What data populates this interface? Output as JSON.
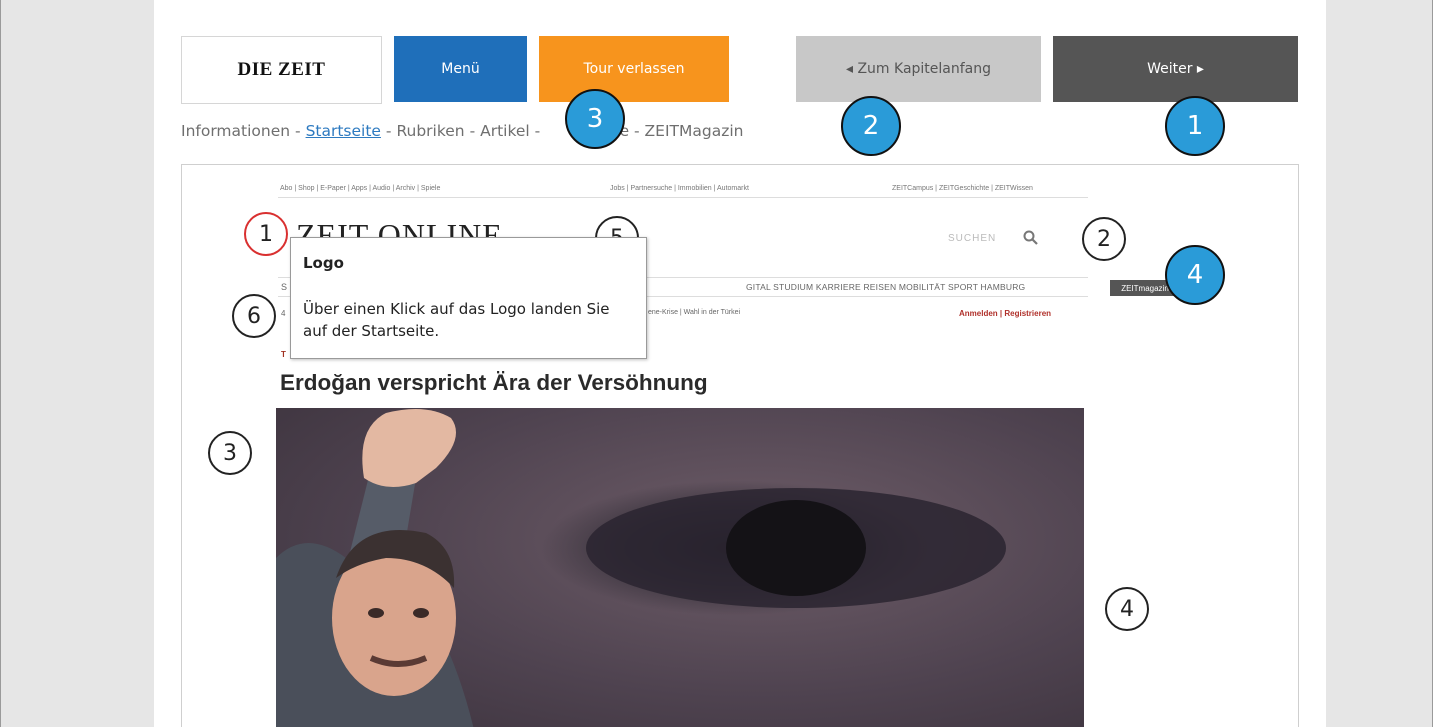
{
  "toolbar": {
    "brand": "DIE ZEIT",
    "menu_label": "Menü",
    "tour_label": "Tour verlassen",
    "kapitel_label": "◂ Zum Kapitelanfang",
    "weiter_label": "Weiter ▸",
    "colors": {
      "menu": "#1f6fba",
      "tour": "#f7941d",
      "kapitel": "#c8c8c8",
      "weiter": "#555555"
    }
  },
  "breadcrumb": {
    "items": [
      "Informationen",
      "Startseite",
      "Rubriken",
      "Artikel",
      "Kommentare",
      "ZEITMagazin"
    ],
    "separator": " - ",
    "active": "Startseite",
    "item_3_visible": "Artikel -",
    "item_5_visible": "ntare - ZEITMagazin"
  },
  "step_markers": {
    "weiter": "1",
    "kapitel": "2",
    "tour": "3",
    "side": "4"
  },
  "screenshot": {
    "top_links_left": "Abo | Shop | E-Paper | Apps | Audio | Archiv | Spiele",
    "top_links_mid": "Jobs | Partnersuche | Immobilien | Automarkt",
    "top_links_right": "ZEITCampus | ZEITGeschichte | ZEITWissen",
    "site_logo": "ZEIT ONLINE",
    "search_label": "SUCHEN",
    "nav_items": "GITAL  STUDIUM  KARRIERE  REISEN  MOBILITÄT  SPORT  HAMBURG",
    "zeitmagazin_badge": "ZEITmagazin",
    "topic_line": "ene-Krise | Wahl in der Türkei",
    "login": "Anmelden | Registrieren",
    "kicker": "T",
    "nav_fragment": "S",
    "fragment_4": "4",
    "headline": "Erdoğan verspricht Ära der Versöhnung",
    "area_markers": [
      "1",
      "2",
      "3",
      "4",
      "5",
      "6"
    ]
  },
  "tooltip": {
    "title": "Logo",
    "body": "Über einen Klick auf das Logo landen Sie auf der Startseite."
  }
}
